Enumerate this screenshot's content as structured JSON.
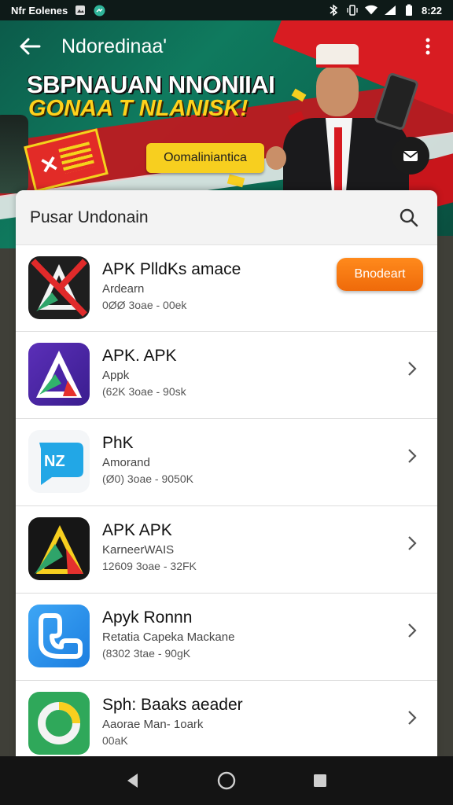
{
  "status_bar": {
    "carrier": "Nfr Eolenes",
    "time": "8:22"
  },
  "app_bar": {
    "title": "Ndoredinaa'"
  },
  "promo": {
    "headline": "SBPNAUAN NNONIIAI",
    "subheadline": "GONAA T NLANISK!",
    "cta_label": "Oomaliniantica",
    "colors": {
      "green": "#0f7a5e",
      "red": "#c7151d",
      "yellow": "#f7cf1f"
    }
  },
  "search": {
    "placeholder_text": "Pusar Undonain",
    "icon": "search-icon"
  },
  "apps": [
    {
      "name": "APK PlldKs amace",
      "subtitle": "Ardearn",
      "meta": "0ØØ 3oae - 00ek",
      "action": "Bnodeart",
      "icon_style": "dark-red-cross"
    },
    {
      "name": "APK. APK",
      "subtitle": "Appk",
      "meta": "(62K 3oae - 90sk",
      "action": null,
      "icon_style": "purple-triangle"
    },
    {
      "name": "PhK",
      "subtitle": "Amorand",
      "meta": "(Ø0) 3oae - 9050K",
      "action": null,
      "icon_style": "blue-chat"
    },
    {
      "name": "APK APK",
      "subtitle": "KarneerWAIS",
      "meta": "12609 3oae - 32FK",
      "action": null,
      "icon_style": "dark-triangle"
    },
    {
      "name": "Apyk Ronnn",
      "subtitle": "Retatia Capeka Mackane",
      "meta": "(8302 3tae - 90gK",
      "action": null,
      "icon_style": "blue-phone"
    },
    {
      "name": "Sph: Baaks aeader",
      "subtitle": "Aaorae Man- 1oark",
      "meta": "00aK",
      "action": null,
      "icon_style": "green-ring"
    }
  ],
  "nav": {
    "back": "back-icon",
    "home": "home-icon",
    "recents": "recents-icon"
  },
  "accent": "#ef6a0a"
}
